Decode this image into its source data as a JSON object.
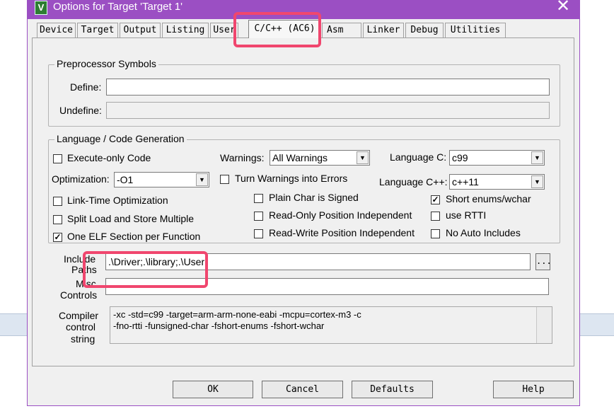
{
  "window": {
    "title": "Options for Target 'Target 1'",
    "app_icon": "keil-uvision-icon",
    "close_glyph": "✕",
    "accent_color": "#9b4fc3"
  },
  "tabs": [
    {
      "label": "Device"
    },
    {
      "label": "Target"
    },
    {
      "label": "Output"
    },
    {
      "label": "Listing"
    },
    {
      "label": "User"
    },
    {
      "label": "C/C++ (AC6)",
      "active": true
    },
    {
      "label": "Asm"
    },
    {
      "label": "Linker"
    },
    {
      "label": "Debug"
    },
    {
      "label": "Utilities"
    }
  ],
  "preprocessor": {
    "title": "Preprocessor Symbols",
    "define_label": "Define:",
    "define_value": "",
    "undefine_label": "Undefine:",
    "undefine_value": ""
  },
  "language": {
    "title": "Language / Code Generation",
    "execute_only": {
      "label": "Execute-only Code",
      "checked": false
    },
    "warnings": {
      "label": "Warnings:",
      "value": "All Warnings"
    },
    "language_c": {
      "label": "Language C:",
      "value": "c99"
    },
    "optimization": {
      "label": "Optimization:",
      "value": "-O1"
    },
    "turn_warnings_errors": {
      "label": "Turn Warnings into Errors",
      "checked": false
    },
    "language_cpp": {
      "label": "Language C++:",
      "value": "c++11"
    },
    "link_time": {
      "label": "Link-Time Optimization",
      "checked": false
    },
    "plain_char": {
      "label": "Plain Char is Signed",
      "checked": false
    },
    "short_enums": {
      "label": "Short enums/wchar",
      "checked": true
    },
    "split_load": {
      "label": "Split Load and Store Multiple",
      "checked": false
    },
    "ro_pi": {
      "label": "Read-Only Position Independent",
      "checked": false
    },
    "use_rtti": {
      "label": "use RTTI",
      "checked": false
    },
    "one_elf": {
      "label": "One ELF Section per Function",
      "checked": true
    },
    "rw_pi": {
      "label": "Read-Write Position Independent",
      "checked": false
    },
    "no_auto_includes": {
      "label": "No Auto Includes",
      "checked": false
    }
  },
  "include": {
    "label_line1": "Include",
    "label_line2": "Paths",
    "value": ".\\Driver;.\\library;.\\User",
    "browse_label": "..."
  },
  "misc": {
    "label_line1": "Misc",
    "label_line2": "Controls",
    "value": ""
  },
  "compiler": {
    "label_line1": "Compiler",
    "label_line2": "control",
    "label_line3": "string",
    "line1": "-xc -std=c99 -target=arm-arm-none-eabi -mcpu=cortex-m3 -c",
    "line2": "-fno-rtti -funsigned-char -fshort-enums -fshort-wchar"
  },
  "buttons": {
    "ok": "OK",
    "cancel": "Cancel",
    "defaults": "Defaults",
    "help": "Help"
  },
  "checkmark": "✓",
  "dropdown_arrow": "▼",
  "highlight_color": "#f0466e"
}
